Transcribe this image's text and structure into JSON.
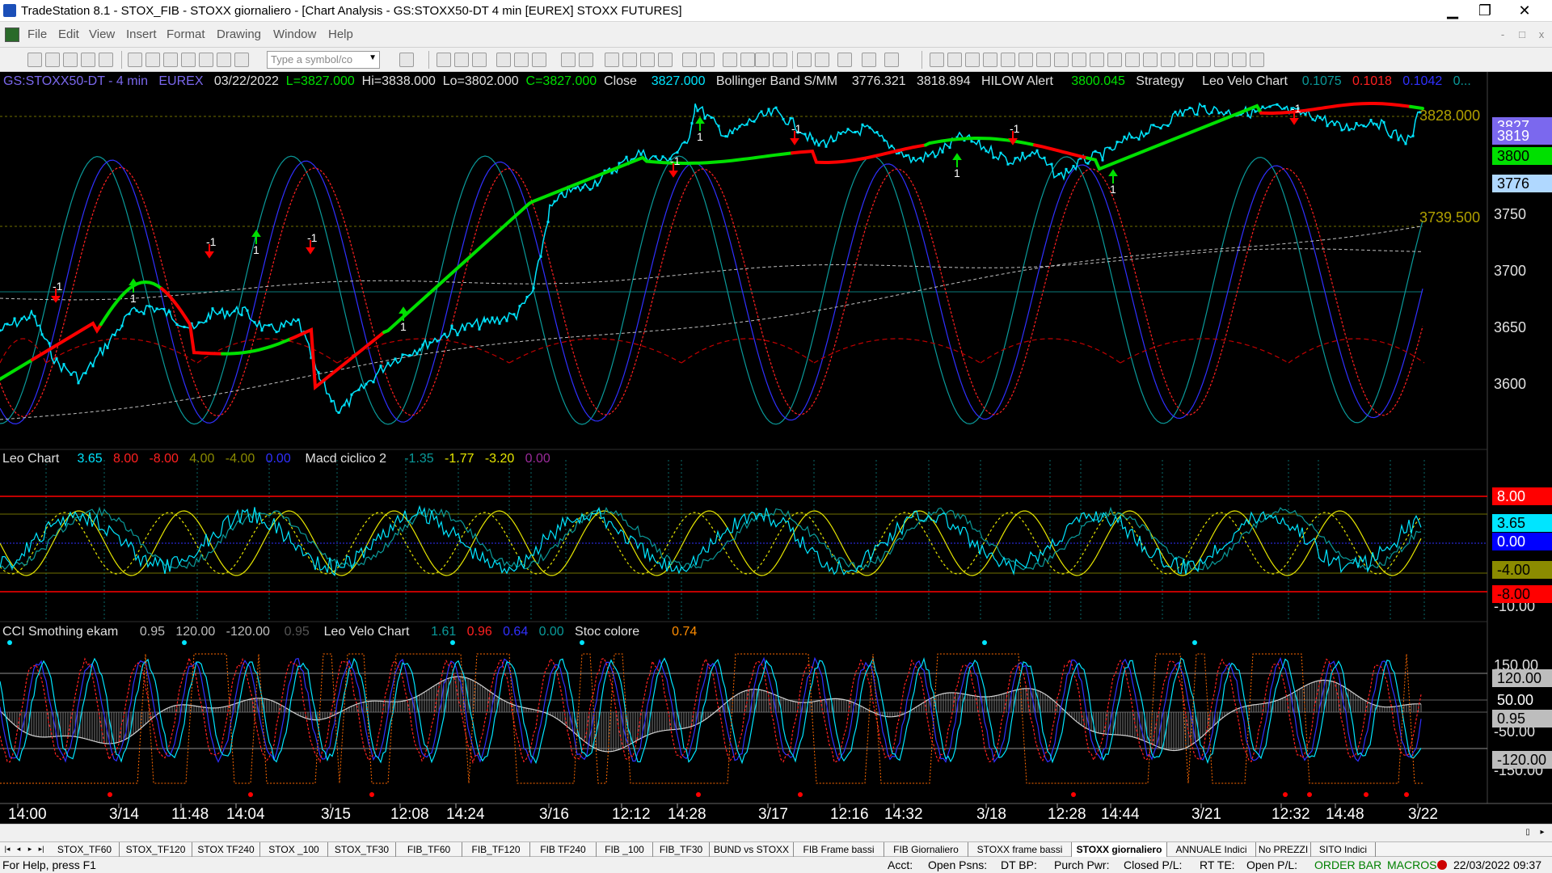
{
  "window": {
    "title": "TradeStation 8.1 - STOX_FIB - STOXX giornaliero - [Chart Analysis - GS:STOXX50-DT  4 min  [EUREX] STOXX FUTURES]",
    "minimize": "▁",
    "restore": "❐",
    "close": "✕"
  },
  "menu": {
    "items": [
      "File",
      "Edit",
      "View",
      "Insert",
      "Format",
      "Drawing",
      "Window",
      "Help"
    ],
    "mdi_min": "-",
    "mdi_restore": "□",
    "mdi_close": "x"
  },
  "toolbar": {
    "symbol_placeholder": "Type a symbol/co"
  },
  "chart": {
    "header": {
      "symbol": "GS:STOXX50-DT - 4 min",
      "exchange": "EUREX",
      "date": "03/22/2022",
      "last": "L=3827.000",
      "high": "Hi=3838.000",
      "low": "Lo=3802.000",
      "close_eq": "C=3827.000",
      "close_lbl": "Close",
      "close_val": "3827.000",
      "bb_lbl": "Bollinger Band S/MM",
      "bb_val1": "3776.321",
      "bb_val2": "3818.894",
      "hilow_lbl": "HILOW Alert",
      "hilow_val": "3800.045",
      "strategy_lbl": "Strategy",
      "leo_lbl": "Leo Velo Chart",
      "leo_v1": "0.1075",
      "leo_v2": "0.1018",
      "leo_v3": "0.1042",
      "leo_v4": "0..."
    },
    "sub1_header": {
      "name": "Leo Chart",
      "v1": "3.65",
      "v2": "8.00",
      "v3": "-8.00",
      "v4": "4.00",
      "v5": "-4.00",
      "v6": "0.00",
      "macd_name": "Macd ciclico 2",
      "m1": "-1.35",
      "m2": "-1.77",
      "m3": "-3.20",
      "m4": "0.00"
    },
    "sub2_header": {
      "name": "CCI Smothing ekam",
      "c1": "0.95",
      "c2": "120.00",
      "c3": "-120.00",
      "c4": "0.95",
      "leo_name": "Leo Velo Chart",
      "l1": "1.61",
      "l2": "0.96",
      "l3": "0.64",
      "l4": "0.00",
      "stoc_name": "Stoc colore",
      "s1": "0.74"
    },
    "price_axis": {
      "ticks": [
        "3750",
        "3700",
        "3650",
        "3600"
      ],
      "hi_level": "3828.000",
      "lo_level": "3739.500",
      "tags": [
        {
          "text": "3827",
          "color": "#7b68ee",
          "fg": "#ffffff"
        },
        {
          "text": "3819",
          "color": "#7b68ee",
          "fg": "#ffffff"
        },
        {
          "text": "3800",
          "color": "#00e000",
          "fg": "#000000"
        },
        {
          "text": "3776",
          "color": "#b0d8ff",
          "fg": "#000000"
        }
      ]
    },
    "sub1_axis": {
      "ticks": [
        "-10.00"
      ],
      "tags": [
        {
          "text": "8.00",
          "color": "#ff0000",
          "fg": "#ffffff"
        },
        {
          "text": "3.65",
          "color": "#00e5ff",
          "fg": "#000000"
        },
        {
          "text": "0.00",
          "color": "#0000ff",
          "fg": "#ffffff"
        },
        {
          "text": "-4.00",
          "color": "#8b8b00",
          "fg": "#000000"
        },
        {
          "text": "-8.00",
          "color": "#ff0000",
          "fg": "#000000"
        }
      ]
    },
    "sub2_axis": {
      "ticks": [
        "150.00",
        "-50.00",
        "-150.00"
      ],
      "tags": [
        {
          "text": "120.00",
          "color": "#bdbdbd",
          "fg": "#000000"
        },
        {
          "text": "50.00",
          "color": "#000000",
          "fg": "#ffffff"
        },
        {
          "text": "0.95",
          "color": "#bdbdbd",
          "fg": "#000000"
        },
        {
          "text": "-120.00",
          "color": "#bdbdbd",
          "fg": "#000000"
        }
      ]
    },
    "time_axis": [
      "14:00",
      "3/14",
      "11:48",
      "14:04",
      "3/15",
      "12:08",
      "14:24",
      "3/16",
      "12:12",
      "14:28",
      "3/17",
      "12:16",
      "14:32",
      "3/18",
      "12:28",
      "14:44",
      "3/21",
      "12:32",
      "14:48",
      "3/22"
    ],
    "signals": [
      "-1",
      "1",
      "-1",
      "1",
      "-1",
      "1",
      "-1",
      "1",
      "-1",
      "1",
      "-1",
      "1",
      "-1"
    ],
    "colors": {
      "price": "#00e5ff",
      "ma_up": "#00e000",
      "ma_down": "#ff0000",
      "bb": "#c0c0c0",
      "osc_red": "#ff2020",
      "osc_blue": "#3030ff",
      "osc_teal": "#0a9a9a",
      "yellow": "#e6e600"
    }
  },
  "tabs": [
    "STOX_TF60",
    "STOX_TF120",
    "STOX TF240",
    "STOX _100",
    "STOX_TF30",
    "FIB_TF60",
    "FIB_TF120",
    "FIB TF240",
    "FIB _100",
    "FIB_TF30",
    "BUND vs STOXX",
    "FIB Frame bassi",
    "FIB Giornaliero",
    "STOXX frame bassi",
    "STOXX giornaliero",
    "ANNUALE Indici",
    "No PREZZI",
    "SITO Indici"
  ],
  "active_tab": "STOXX giornaliero",
  "status": {
    "help": "For Help, press F1",
    "acct": "Acct:",
    "open_psns": "Open Psns:",
    "dt_bp": "DT BP:",
    "purch_pwr": "Purch Pwr:",
    "closed_pl": "Closed P/L:",
    "rt_te": "RT TE:",
    "open_pl": "Open P/L:",
    "order_bar": "ORDER BAR",
    "macros": "MACROS",
    "datetime": "22/03/2022 09:37"
  }
}
